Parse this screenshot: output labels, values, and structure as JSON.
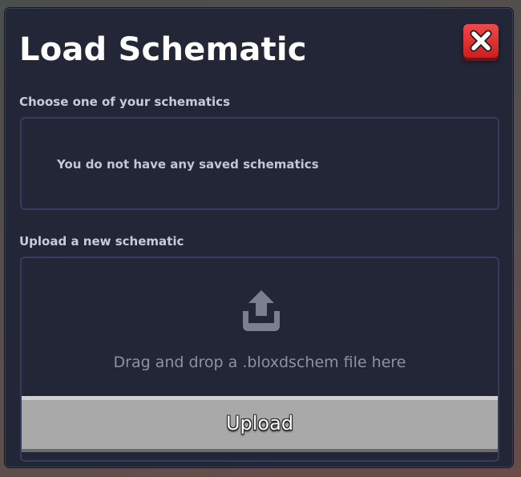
{
  "dialog": {
    "title": "Load Schematic",
    "close_icon": "close-x-icon"
  },
  "saved_section": {
    "label": "Choose one of your schematics",
    "empty_message": "You do not have any saved schematics"
  },
  "upload_section": {
    "label": "Upload a new schematic",
    "icon": "upload-icon",
    "drop_text": "Drag and drop a .bloxdschem file here",
    "button_label": "Upload"
  },
  "colors": {
    "background": "#222637",
    "box_border": "#353c5c",
    "close_button": "#dd2c2c",
    "upload_button": "#a9a9a9"
  }
}
